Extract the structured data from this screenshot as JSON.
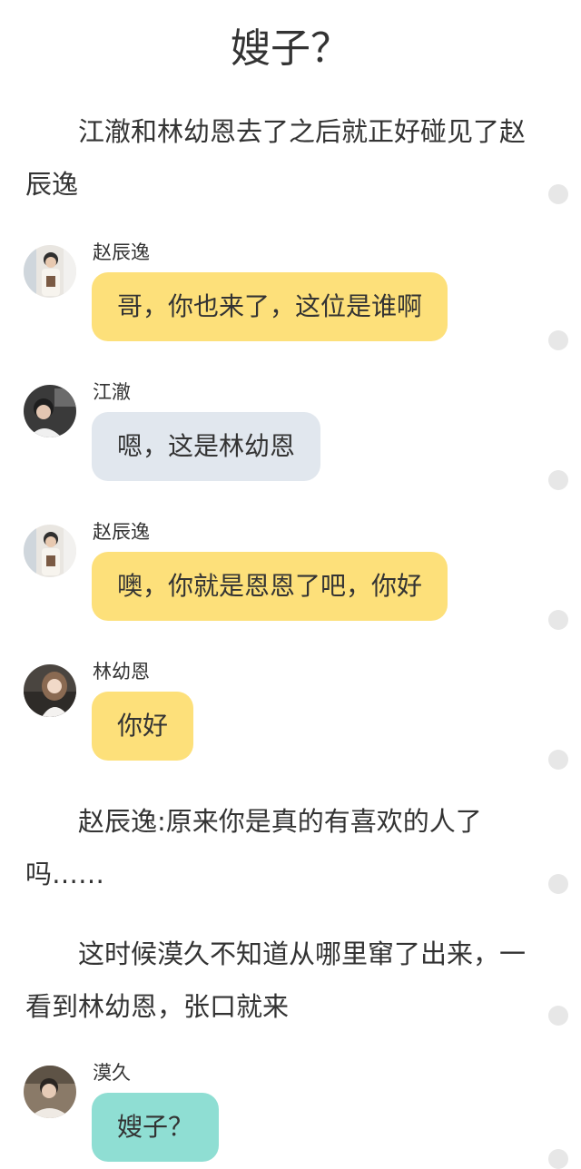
{
  "title": "嫂子？",
  "paragraphs": [
    "江澈和林幼恩去了之后就正好碰见了赵辰逸",
    "赵辰逸:原来你是真的有喜欢的人了吗……",
    "这时候漠久不知道从哪里窜了出来，一看到林幼恩，张口就来"
  ],
  "messages": [
    {
      "name": "赵辰逸",
      "text": "哥，你也来了，这位是谁啊",
      "avatar": "boy-avatar"
    },
    {
      "name": "江澈",
      "text": "嗯，这是林幼恩",
      "avatar": "boy-dark-avatar"
    },
    {
      "name": "赵辰逸",
      "text": "噢，你就是恩恩了吧，你好",
      "avatar": "boy-avatar"
    },
    {
      "name": "林幼恩",
      "text": "你好",
      "avatar": "girl-avatar"
    },
    {
      "name": "漠久",
      "text": "嫂子？",
      "avatar": "boy-avatar-2"
    }
  ],
  "colors": {
    "bubble_yellow": "#fde07a",
    "bubble_gray": "#e1e7ee",
    "bubble_teal": "#8fded3",
    "side_dot": "#e7e7e7"
  }
}
